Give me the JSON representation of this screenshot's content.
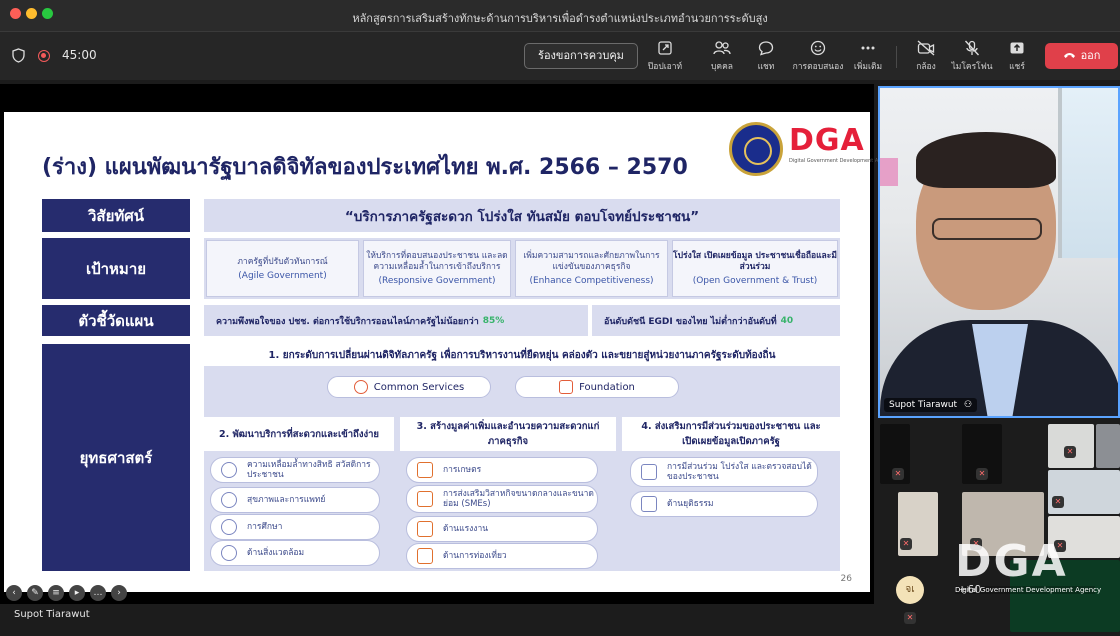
{
  "window": {
    "title": "หลักสูตรการเสริมสร้างทักษะด้านการบริหารเพื่อดำรงตำแหน่งประเภทอำนวยการระดับสูง"
  },
  "toolbar": {
    "timer": "45:00",
    "request_control_label": "ร้องขอการควบคุม",
    "tools": [
      {
        "icon": "popout-icon",
        "label": "ป๊อปเอาท์"
      },
      {
        "icon": "people-icon",
        "label": "บุคคล"
      },
      {
        "icon": "chat-icon",
        "label": "แชท"
      },
      {
        "icon": "reactions-icon",
        "label": "การตอบสนอง"
      },
      {
        "icon": "more-icon",
        "label": "เพิ่มเติม"
      },
      {
        "icon": "camera-off-icon",
        "label": "กล้อง"
      },
      {
        "icon": "mic-off-icon",
        "label": "ไมโครโฟน"
      },
      {
        "icon": "share-icon",
        "label": "แชร์"
      }
    ],
    "leave_label": "ออก"
  },
  "slide": {
    "title": "(ร่าง) แผนพัฒนารัฐบาลดิจิทัลของประเทศไทย พ.ศ. 2566 – 2570",
    "logo_text": "DGA",
    "logo_subtext": "Digital Government Development Agency",
    "row_labels": {
      "vision": "วิสัยทัศน์",
      "goal": "เป้าหมาย",
      "indicator": "ตัวชี้วัดแผน",
      "strategy": "ยุทธศาสตร์"
    },
    "vision": "“บริการภาครัฐสะดวก โปร่งใส ทันสมัย ตอบโจทย์ประชาชน”",
    "goals": [
      {
        "th": "ภาครัฐที่ปรับตัวทันการณ์",
        "en": "(Agile Government)"
      },
      {
        "th": "ให้บริการที่ตอบสนองประชาชน และลดความเหลื่อมล้ำในการเข้าถึงบริการ",
        "en": "(Responsive Government)"
      },
      {
        "th": "เพิ่มความสามารถและศักยภาพในการแข่งขันของภาคธุรกิจ",
        "en": "(Enhance Competitiveness)"
      },
      {
        "th": "โปร่งใส เปิดเผยข้อมูล ประชาชนเชื่อถือและมีส่วนร่วม",
        "en": "(Open Government & Trust)"
      }
    ],
    "indicators": [
      {
        "text": "ความพึงพอใจของ ปชช. ต่อการใช้บริการออนไลน์ภาครัฐไม่น้อยกว่า",
        "value": "85%"
      },
      {
        "text": "อันดับดัชนี EGDI ของไทย ไม่ต่ำกว่าอันดับที่",
        "value": "40"
      }
    ],
    "strategy_1": "1. ยกระดับการเปลี่ยนผ่านดิจิทัลภาครัฐ   เพื่อการบริหารงานที่ยืดหยุ่น คล่องตัว และขยายสู่หน่วยงานภาครัฐระดับท้องถิ่น",
    "strategy_1_items": [
      "Common Services",
      "Foundation"
    ],
    "strategy_cols": [
      {
        "heading": "2. พัฒนาบริการที่สะดวกและเข้าถึงง่าย",
        "items": [
          "ความเหลื่อมล้ำทางสิทธิ สวัสดิการประชาชน",
          "สุขภาพและการแพทย์",
          "การศึกษา",
          "ด้านสิ่งแวดล้อม"
        ]
      },
      {
        "heading": "3. สร้างมูลค่าเพิ่มและอำนวยความสะดวกแก่ภาคธุรกิจ",
        "items": [
          "การเกษตร",
          "การส่งเสริมวิสาหกิจขนาดกลางและขนาดย่อม (SMEs)",
          "ด้านแรงงาน",
          "ด้านการท่องเที่ยว"
        ]
      },
      {
        "heading": "4. ส่งเสริมการมีส่วนร่วมของประชาชน และเปิดเผยข้อมูลเปิดภาครัฐ",
        "items": [
          "การมีส่วนร่วม โปร่งใส และตรวจสอบได้ของประชาชน",
          "ด้านยุติธรรม"
        ]
      }
    ],
    "page_number": "26"
  },
  "presenter_name": "Supot Tiarawut",
  "speaker": {
    "name": "Supot Tiarawut"
  },
  "gallery": {
    "more_count": "+60",
    "avatar_initials": "จเ",
    "watermark_text": "DGA",
    "watermark_sub": "Digital Government Development Agency"
  },
  "colors": {
    "navy": "#262c6e",
    "lavender": "#d9dcef",
    "accent_red": "#e5203a",
    "leave_red": "#e0404a",
    "active_border": "#5aa3ff"
  }
}
